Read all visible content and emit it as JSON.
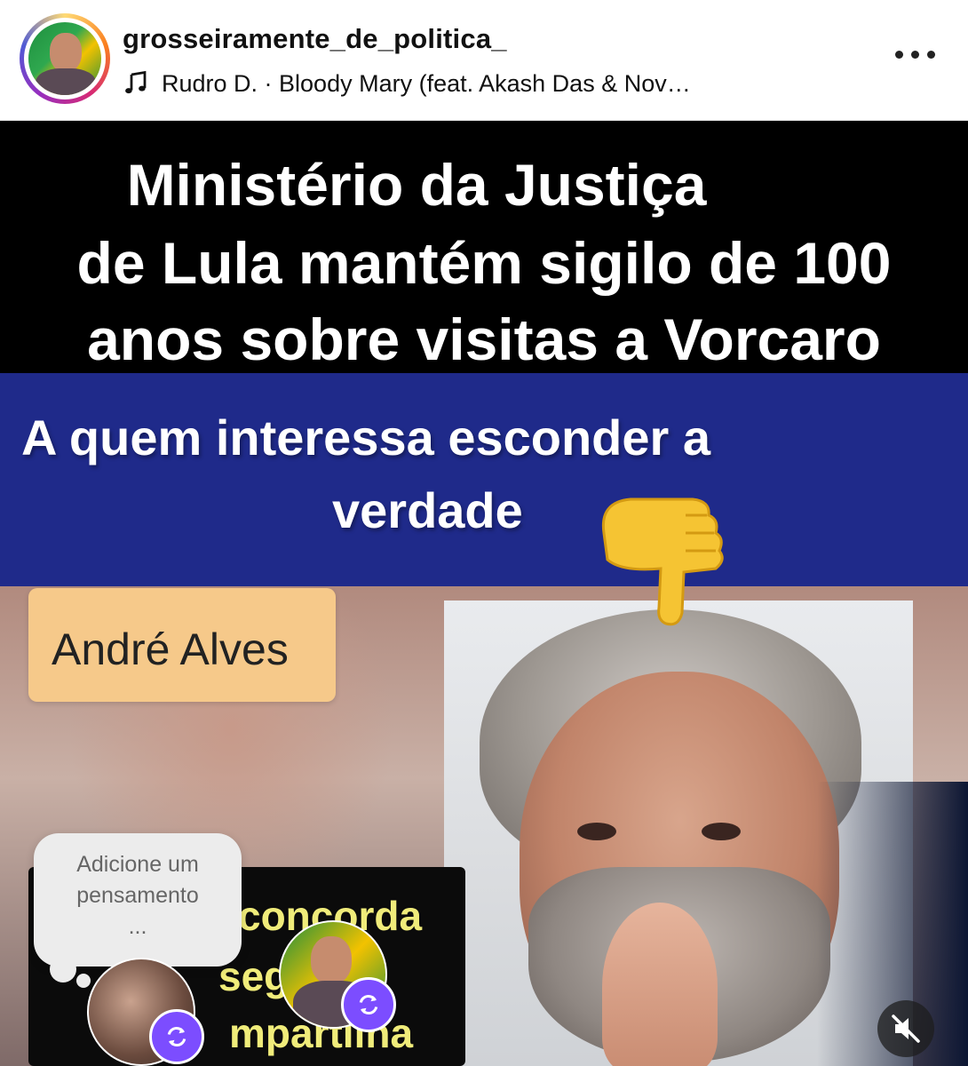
{
  "header": {
    "username": "grosseiramente_de_politica_",
    "audio": "Rudro D. · Bloody Mary (feat. Akash Das & Nov…",
    "more_icon": "more-horizontal-icon",
    "music_icon": "music-note-icon"
  },
  "post": {
    "headline_lines": [
      "Ministério da Justiça",
      "de Lula mantém sigilo de 100",
      "anos sobre visitas a Vorcaro"
    ],
    "question_lines": [
      "A quem interessa esconder a",
      "verdade"
    ],
    "name_tag": "André Alves",
    "promo_lines": [
      "concorda",
      "segue",
      "mpartilha"
    ],
    "thought_bubble": [
      "Adicione um",
      "pensamento",
      "..."
    ],
    "colors": {
      "headline_bg": "#000000",
      "question_bg": "#1f2a8a",
      "name_tag_bg": "#f6c98a",
      "promo_text": "#f0ec7a",
      "repost_badge": "#7c4dff"
    },
    "icons": [
      "pointing-down-hand-icon",
      "repost-icon",
      "mute-icon"
    ]
  }
}
